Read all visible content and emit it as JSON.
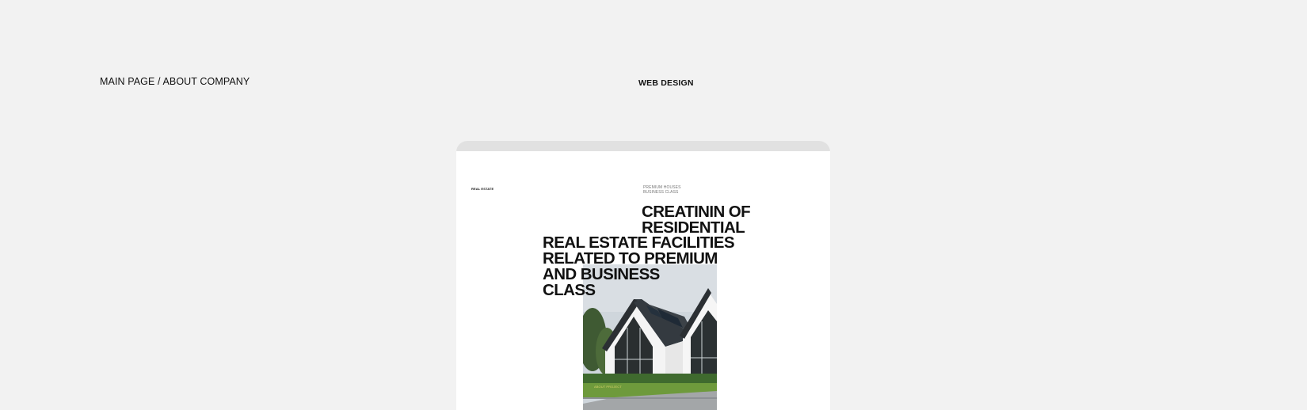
{
  "breadcrumb": "MAIN PAGE / ABOUT COMPANY",
  "category": "WEB DESIGN",
  "mockup": {
    "logo": "REAL ESTATE",
    "tagline": [
      "PREMIUM HOUSES",
      "BUSINESS CLASS"
    ],
    "headline_top": [
      "CREATININ OF",
      "RESIDENTIAL"
    ],
    "headline_main": [
      "REAL ESTATE FACILITIES",
      "RELATED TO PREMIUM",
      "AND BUSINESS",
      "CLASS"
    ],
    "photo_caption": "ABOUT PROJECT"
  },
  "colors": {
    "page_background": "#f2f2f2",
    "device_bar": "#e1e1e1",
    "device_screen": "#ffffff",
    "text": "#111111"
  },
  "icons": {
    "photo": "modern-house-photo"
  }
}
